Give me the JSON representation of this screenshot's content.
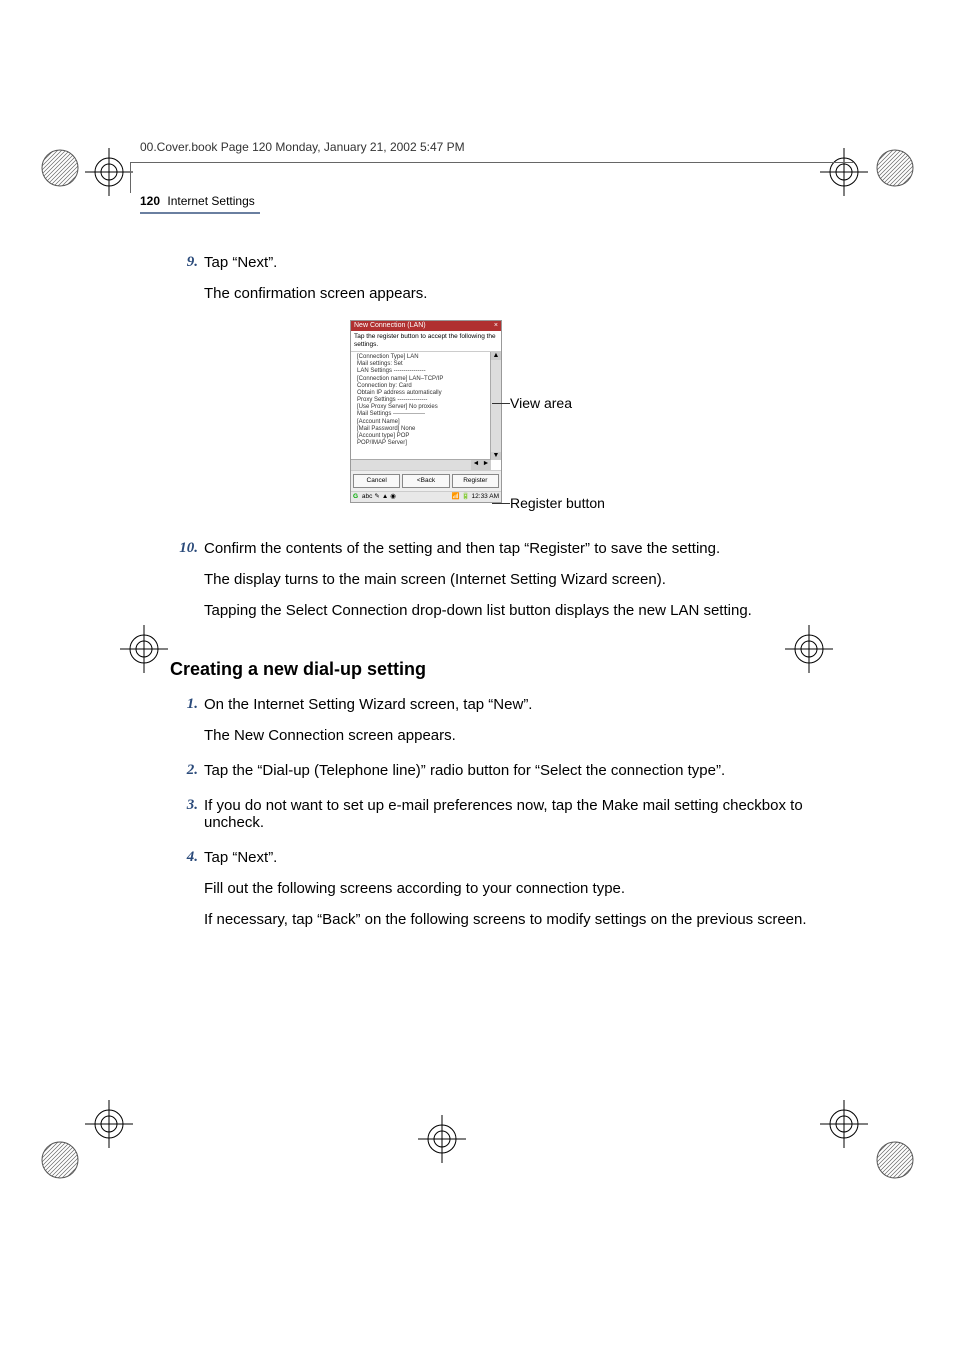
{
  "header_line": "00.Cover.book  Page 120  Monday, January 21, 2002  5:47 PM",
  "running_head": {
    "page": "120",
    "section": "Internet Settings"
  },
  "step9": {
    "num": "9.",
    "line1": "Tap “Next”.",
    "line2": "The confirmation screen appears."
  },
  "figure": {
    "title": "New Connection (LAN)",
    "close_glyph": "×",
    "intro": "Tap the register button to accept the following the settings.",
    "lines": [
      "[Connection Type] LAN",
      "Mail settings: Set",
      "LAN Settings ----------------",
      "[Connection name] LAN–TCP/IP",
      "Connection by: Card",
      "Obtain IP address automatically",
      "Proxy Settings ---------------",
      "[Use Proxy Server] No proxies",
      "Mail Settings ----------------",
      "[Account Name]",
      "[Mail Password] None",
      "[Account type] POP",
      "POP/IMAP Server]"
    ],
    "buttons": {
      "cancel": "Cancel",
      "back": "<Back",
      "register": "Register"
    },
    "status": {
      "left_glyphs": "G abc ✎ ▲ ●",
      "right": "12:33 AM"
    },
    "callouts": {
      "view": "View area",
      "register": "Register button"
    }
  },
  "step10": {
    "num": "10.",
    "p1": "Confirm the contents of the setting and then tap “Register” to save the setting.",
    "p2": "The display turns to the main screen (Internet Setting Wizard screen).",
    "p3": "Tapping the Select Connection drop-down list button displays the new LAN setting."
  },
  "h2": "Creating a new dial-up setting",
  "dial": {
    "s1": {
      "num": "1.",
      "p1": "On the Internet Setting Wizard screen, tap “New”.",
      "p2": "The New Connection screen appears."
    },
    "s2": {
      "num": "2.",
      "p1": "Tap the “Dial-up (Telephone line)” radio button for “Select the connection type”."
    },
    "s3": {
      "num": "3.",
      "p1": "If you do not  want  to set up e-mail preferences now, tap the Make mail setting checkbox to uncheck."
    },
    "s4": {
      "num": "4.",
      "p1": "Tap “Next”.",
      "p2": "Fill out the following screens according to your connection type.",
      "p3": "If necessary, tap “Back” on the following screens to modify settings on the previous screen."
    }
  }
}
